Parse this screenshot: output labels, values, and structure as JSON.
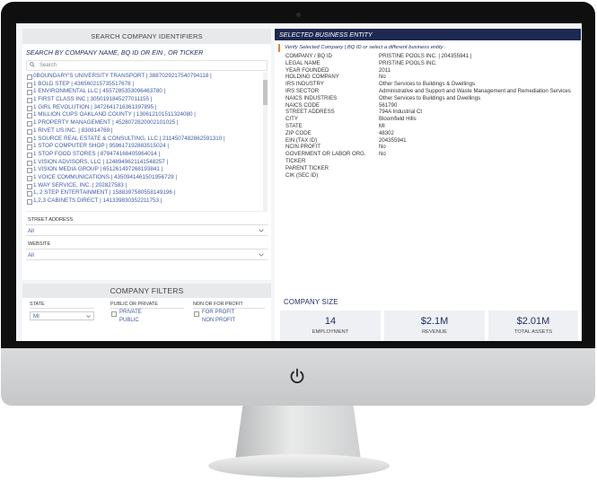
{
  "search_panel": {
    "header": "SEARCH COMPANY IDENTIFIERS",
    "title": "SEARCH BY COMPANY NAME,  BQ ID OR EIN , OR TICKER",
    "search_placeholder": "Search",
    "items": [
      "0BOUNDARY'S UNIVERSITY TRANSPORT | 388702921754​0794118 |",
      "1 BOLD STEP | 4365602157355176​78 |",
      "1 ENVIRONMENTAL LLC | 4557285353096463780 |",
      "1 FIRST CLASS INC | 3050191845277011155 |",
      "1 GIRL REVOLUTION | 347264171636139789​5 |",
      "1 MILLION CUPS OAKLAND COUNTY | 1306121015113240​80 |",
      "1 PROPERTY MANAGEMENT | 452807282000210102​5 |",
      "1 RIVET US INC. | 830814769 |",
      "1 SOURCE REAL ESTATE & CONSULTING, LLC | 2114507482862591310 |",
      "1 STOP COMPUTER SHOP | 9596171928835150​24 |",
      "1 STOP FOOD STORES | 879474168405964014 |",
      "1 VISION ADVISORS, LLC | 1248949621141548257 |",
      "1 VISION MEDIA GROUP | 651261497268193841 |",
      "1 VOICE COMMUNICATIONS | 4350941461501956729 |",
      "1 WAY SERVICE, INC. | 202827583 |",
      "1, 2 STEP ENTERTAINMENT | 1588397580558149196 |",
      "1,2,3 CABINETS DIRECT | 1413398303522117​53 |"
    ],
    "street_label": "STREET ADDRESS",
    "street_value": "All",
    "website_label": "WEBSITE",
    "website_value": "All"
  },
  "filters": {
    "header": "COMPANY FILTERS",
    "state_label": "STATE",
    "state_value": "MI",
    "pubpriv_label": "PUBLIC OR PRIVATE",
    "pubpriv_options": [
      "PRIVATE",
      "PUBLIC"
    ],
    "profit_label": "NON OR FOR PROFIT",
    "profit_options": [
      "FOR PROFIT",
      "NON PROFIT"
    ]
  },
  "entity": {
    "header": "SELECTED BUSINESS ENTITY",
    "verify": "Verify Selected Company | BQ ID or select a different business entity .",
    "rows": [
      {
        "k": "COMPANY / BQ ID",
        "v": "PRISTINE POOLS INC. | 204355941 |"
      },
      {
        "k": "LEGAL NAME",
        "v": "PRISTINE POOLS INC."
      },
      {
        "k": "YEAR FOUNDED",
        "v": "2011"
      },
      {
        "k": "HOLDING COMPANY",
        "v": "No"
      },
      {
        "k": "IRS INDUSTRY",
        "v": "Other Services to Buildings & Dwellings"
      },
      {
        "k": "IRS SECTOR",
        "v": "Administrative and Support and Waste Management and Remediation Services"
      },
      {
        "k": "NAICS INDUSTRIES",
        "v": "Other Services to Buildings and Dwellings"
      },
      {
        "k": "NAICS CODE",
        "v": "561790"
      },
      {
        "k": "STREET ADDRESS",
        "v": "794A Industrial Ct"
      },
      {
        "k": "CITY",
        "v": "Bloomfield Hills"
      },
      {
        "k": "STATE",
        "v": "MI"
      },
      {
        "k": "ZIP CODE",
        "v": "48302"
      },
      {
        "k": "EIN (TAX ID)",
        "v": "204355941"
      },
      {
        "k": "NCIN PROFIT",
        "v": "No"
      },
      {
        "k": "GOVERMENT OR LABOR ORG.",
        "v": "No"
      },
      {
        "k": "TICKER",
        "v": ""
      },
      {
        "k": "PARENT TICKER",
        "v": ""
      },
      {
        "k": "CIK (SEC ID)",
        "v": ""
      }
    ]
  },
  "company_size": {
    "title": "COMPANY SIZE",
    "stats": [
      {
        "value": "14",
        "label": "EMPLOYMENT"
      },
      {
        "value": "$2.1M",
        "label": "REVENUE"
      },
      {
        "value": "$2.01M",
        "label": "TOTAL ASSETS"
      }
    ]
  }
}
